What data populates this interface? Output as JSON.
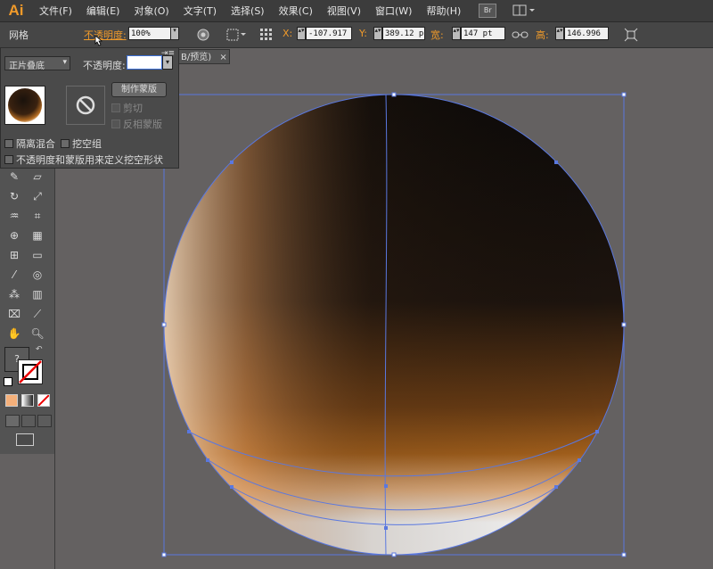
{
  "app": {
    "logo": "Ai"
  },
  "menu": [
    "文件(F)",
    "编辑(E)",
    "对象(O)",
    "文字(T)",
    "选择(S)",
    "效果(C)",
    "视图(V)",
    "窗口(W)",
    "帮助(H)"
  ],
  "menu_icons": {
    "bridge": "Br"
  },
  "control_bar": {
    "object_type": "网格",
    "opacity_label": "不透明度:",
    "opacity_value": "100%",
    "x_label": "X:",
    "x_value": "-107.917",
    "y_label": "Y:",
    "y_value": "389.12 p",
    "w_label": "宽:",
    "w_value": "147 pt",
    "h_label": "高:",
    "h_value": "146.996"
  },
  "transparency_panel": {
    "blend_mode": "正片叠底",
    "opacity_label": "不透明度:",
    "opacity_value": "100%",
    "make_mask_button": "制作蒙版",
    "clip_label": "剪切",
    "invert_mask_label": "反相蒙版",
    "isolate_blending_label": "隔离混合",
    "knockout_group_label": "挖空组",
    "opacity_mask_knockout_label": "不透明度和蒙版用来定义挖空形状"
  },
  "document_tab": {
    "label": "B/预览)",
    "close": "×"
  },
  "toolbar": {
    "unknown_color": "?"
  },
  "colors": {
    "accent": "#f09a2a",
    "selection": "#5577dd",
    "panel_bg": "#4a4a4a",
    "canvas_bg": "#646161"
  }
}
